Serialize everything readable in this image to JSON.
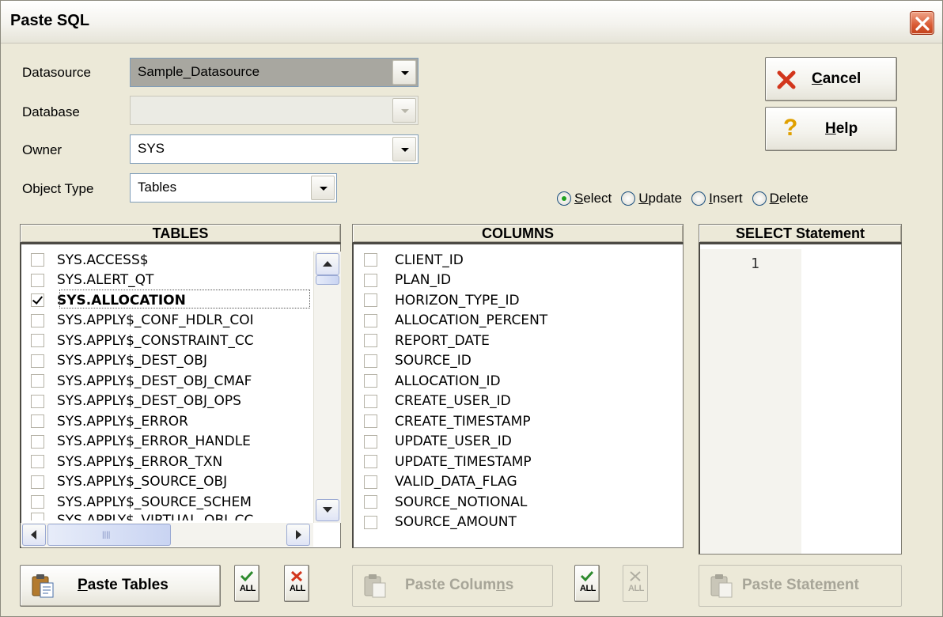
{
  "window": {
    "title": "Paste SQL"
  },
  "form": {
    "datasource": {
      "label": "Datasource",
      "value": "Sample_Datasource"
    },
    "database": {
      "label": "Database",
      "value": ""
    },
    "owner": {
      "label": "Owner",
      "value": "SYS"
    },
    "object_type": {
      "label": "Object Type",
      "value": "Tables"
    }
  },
  "actions": {
    "cancel": {
      "mnemonic": "C",
      "rest": "ancel"
    },
    "help": {
      "mnemonic": "H",
      "rest": "elp"
    }
  },
  "statement_types": {
    "selected": "Select",
    "options": [
      {
        "mnemonic": "S",
        "rest": "elect"
      },
      {
        "mnemonic": "U",
        "rest": "pdate"
      },
      {
        "mnemonic": "I",
        "rest": "nsert"
      },
      {
        "mnemonic": "D",
        "rest": "elete"
      }
    ]
  },
  "tables_panel": {
    "header": "TABLES",
    "items": [
      {
        "label": "SYS.ACCESS$",
        "checked": false
      },
      {
        "label": "SYS.ALERT_QT",
        "checked": false
      },
      {
        "label": "SYS.ALLOCATION",
        "checked": true
      },
      {
        "label": "SYS.APPLY$_CONF_HDLR_COI",
        "checked": false
      },
      {
        "label": "SYS.APPLY$_CONSTRAINT_CC",
        "checked": false
      },
      {
        "label": "SYS.APPLY$_DEST_OBJ",
        "checked": false
      },
      {
        "label": "SYS.APPLY$_DEST_OBJ_CMAF",
        "checked": false
      },
      {
        "label": "SYS.APPLY$_DEST_OBJ_OPS",
        "checked": false
      },
      {
        "label": "SYS.APPLY$_ERROR",
        "checked": false
      },
      {
        "label": "SYS.APPLY$_ERROR_HANDLE",
        "checked": false
      },
      {
        "label": "SYS.APPLY$_ERROR_TXN",
        "checked": false
      },
      {
        "label": "SYS.APPLY$_SOURCE_OBJ",
        "checked": false
      },
      {
        "label": "SYS.APPLY$_SOURCE_SCHEM",
        "checked": false
      },
      {
        "label": "SYS.APPLY$_VIRTUAL_OBJ_CC",
        "checked": false
      }
    ]
  },
  "columns_panel": {
    "header": "COLUMNS",
    "items": [
      "CLIENT_ID",
      "PLAN_ID",
      "HORIZON_TYPE_ID",
      "ALLOCATION_PERCENT",
      "REPORT_DATE",
      "SOURCE_ID",
      "ALLOCATION_ID",
      "CREATE_USER_ID",
      "CREATE_TIMESTAMP",
      "UPDATE_USER_ID",
      "UPDATE_TIMESTAMP",
      "VALID_DATA_FLAG",
      "SOURCE_NOTIONAL",
      "SOURCE_AMOUNT"
    ]
  },
  "statement_panel": {
    "header": "SELECT Statement",
    "line_number": "1"
  },
  "bottom": {
    "paste_tables": {
      "mnemonic": "P",
      "rest": "aste Tables"
    },
    "paste_columns": {
      "prefix": "Paste Colum",
      "mnemonic": "n",
      "rest": "s"
    },
    "paste_statement": {
      "prefix": "Paste State",
      "mnemonic": "m",
      "rest": "ent"
    },
    "all_label": "ALL"
  },
  "colors": {
    "accent": "#316ac5",
    "cancel_red": "#d2361c",
    "help_yellow": "#e0a000",
    "check_green": "#2d8a2d"
  }
}
